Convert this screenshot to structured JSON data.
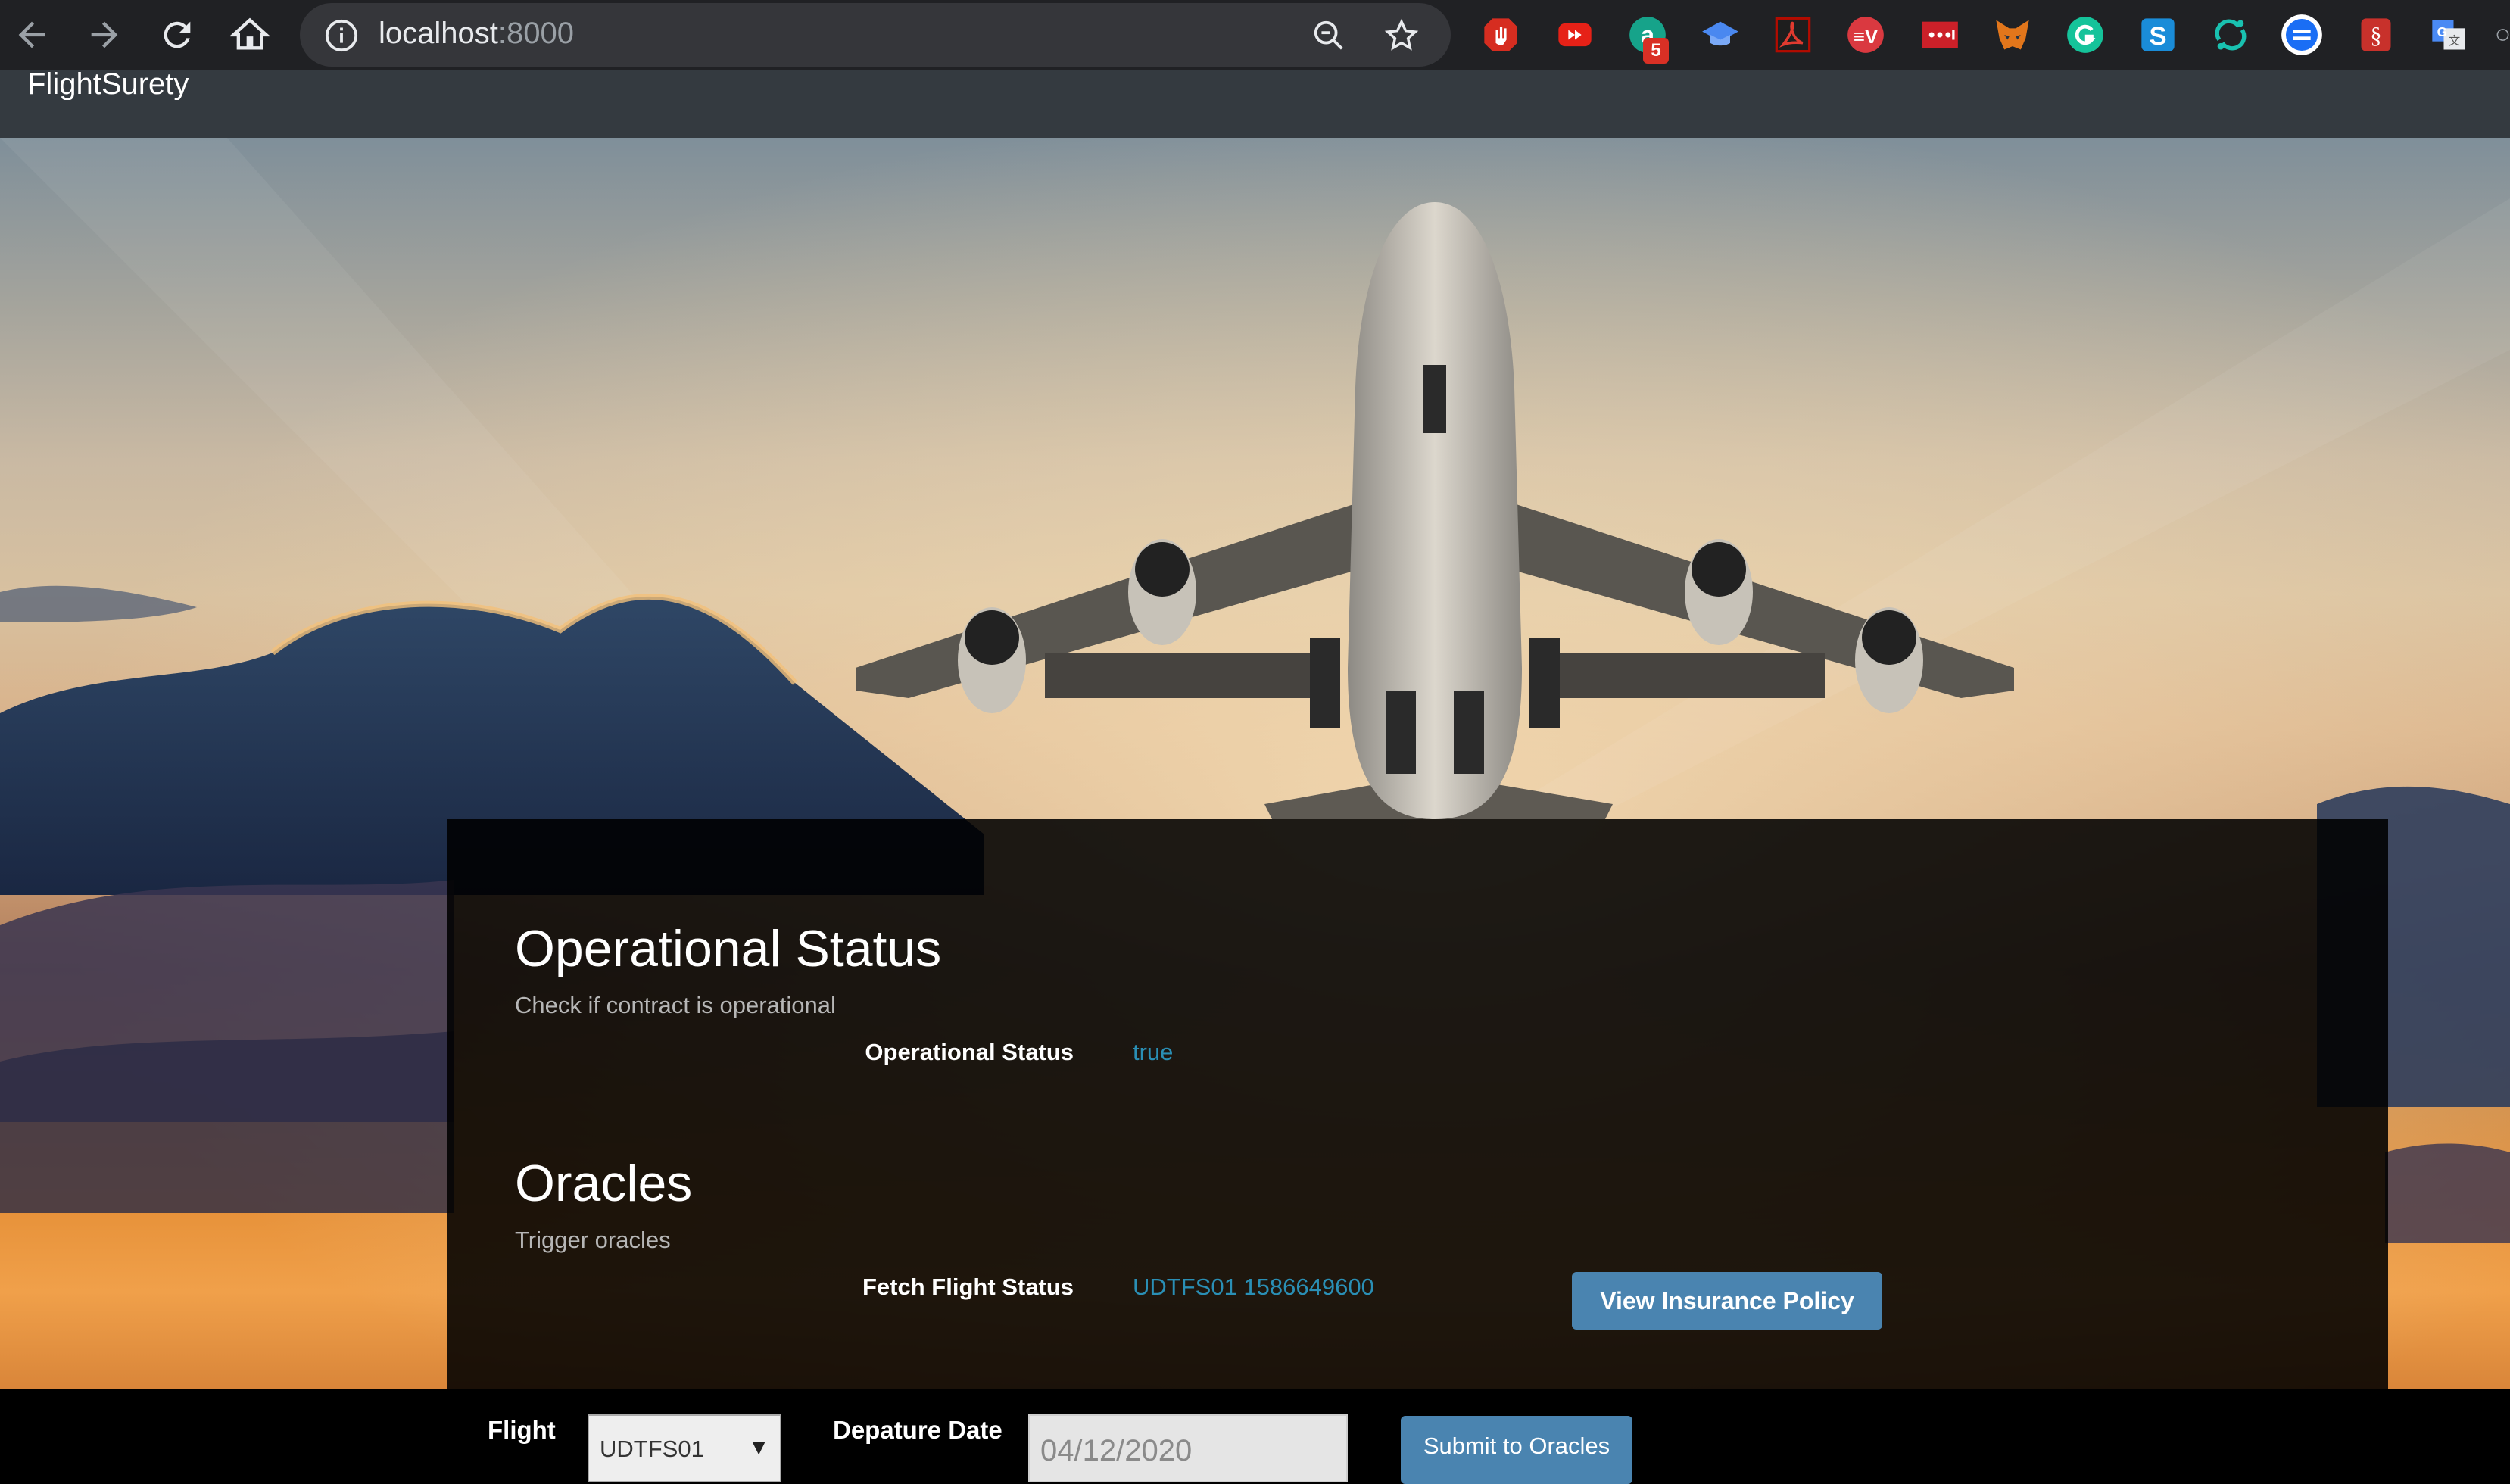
{
  "browser": {
    "url_host": "localhost",
    "url_port": ":8000",
    "extension_badge": "5"
  },
  "navbar": {
    "brand": "FlightSurety"
  },
  "operational": {
    "title": "Operational Status",
    "subtitle": "Check if contract is operational",
    "label": "Operational Status",
    "value": "true"
  },
  "oracles": {
    "title": "Oracles",
    "subtitle": "Trigger oracles",
    "label": "Fetch Flight Status",
    "value": "UDTFS01 1586649600",
    "view_policy_label": "View Insurance Policy"
  },
  "form": {
    "flight_label": "Flight",
    "flight_selected": "UDTFS01",
    "date_label": "Depature Date",
    "date_value": "04/12/2020",
    "submit_label": "Submit to Oracles"
  },
  "colors": {
    "chrome_bg": "#202124",
    "navbar_bg": "#343a40",
    "accent_value": "#2a8fb5",
    "button_bg": "#4a84b0"
  }
}
